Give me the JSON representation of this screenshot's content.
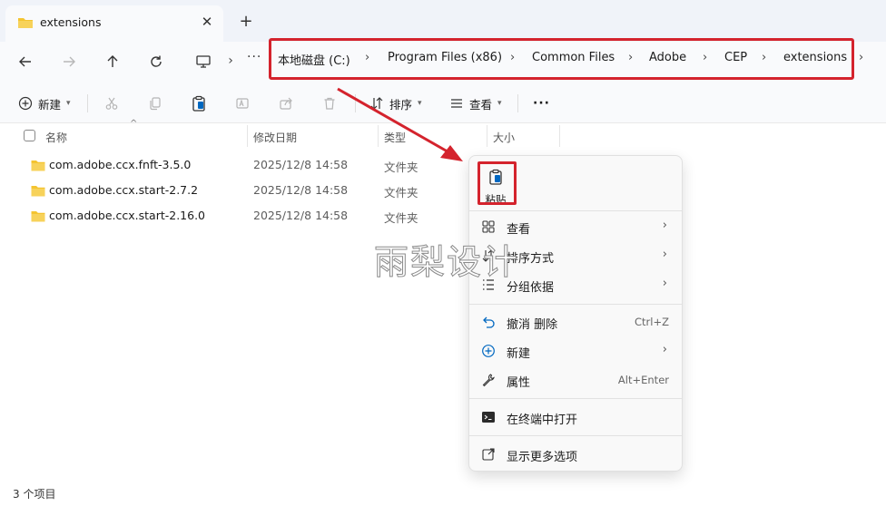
{
  "tab": {
    "title": "extensions",
    "close_glyph": "✕",
    "new_glyph": "+"
  },
  "nav": {
    "more_glyph": "···",
    "chevron": "›"
  },
  "breadcrumb": [
    "本地磁盘 (C:)",
    "Program Files (x86)",
    "Common Files",
    "Adobe",
    "CEP",
    "extensions"
  ],
  "toolbar": {
    "new_label": "新建",
    "sort_label": "排序",
    "view_label": "查看",
    "more_glyph": "···"
  },
  "columns": {
    "name": "名称",
    "date": "修改日期",
    "type": "类型",
    "size": "大小"
  },
  "files": [
    {
      "name": "com.adobe.ccx.fnft-3.5.0",
      "date": "2025/12/8 14:58",
      "type": "文件夹"
    },
    {
      "name": "com.adobe.ccx.start-2.7.2",
      "date": "2025/12/8 14:58",
      "type": "文件夹"
    },
    {
      "name": "com.adobe.ccx.start-2.16.0",
      "date": "2025/12/8 14:58",
      "type": "文件夹"
    }
  ],
  "status": {
    "count_text": "3 个项目"
  },
  "watermark": "雨梨设计",
  "context_menu": {
    "paste_label": "粘贴",
    "items": [
      {
        "label": "查看",
        "icon": "grid-icon",
        "submenu": true
      },
      {
        "label": "排序方式",
        "icon": "sort-icon",
        "submenu": true
      },
      {
        "label": "分组依据",
        "icon": "group-icon",
        "submenu": true
      },
      {
        "label": "撤消 删除",
        "icon": "undo-icon",
        "shortcut": "Ctrl+Z"
      },
      {
        "label": "新建",
        "icon": "plus-circle-icon",
        "submenu": true
      },
      {
        "label": "属性",
        "icon": "wrench-icon",
        "shortcut": "Alt+Enter"
      },
      {
        "label": "在终端中打开",
        "icon": "terminal-icon"
      },
      {
        "label": "显示更多选项",
        "icon": "open-external-icon"
      }
    ]
  },
  "colors": {
    "highlight": "#d4232d",
    "folder": "#f4c430",
    "accent": "#0067c0"
  }
}
